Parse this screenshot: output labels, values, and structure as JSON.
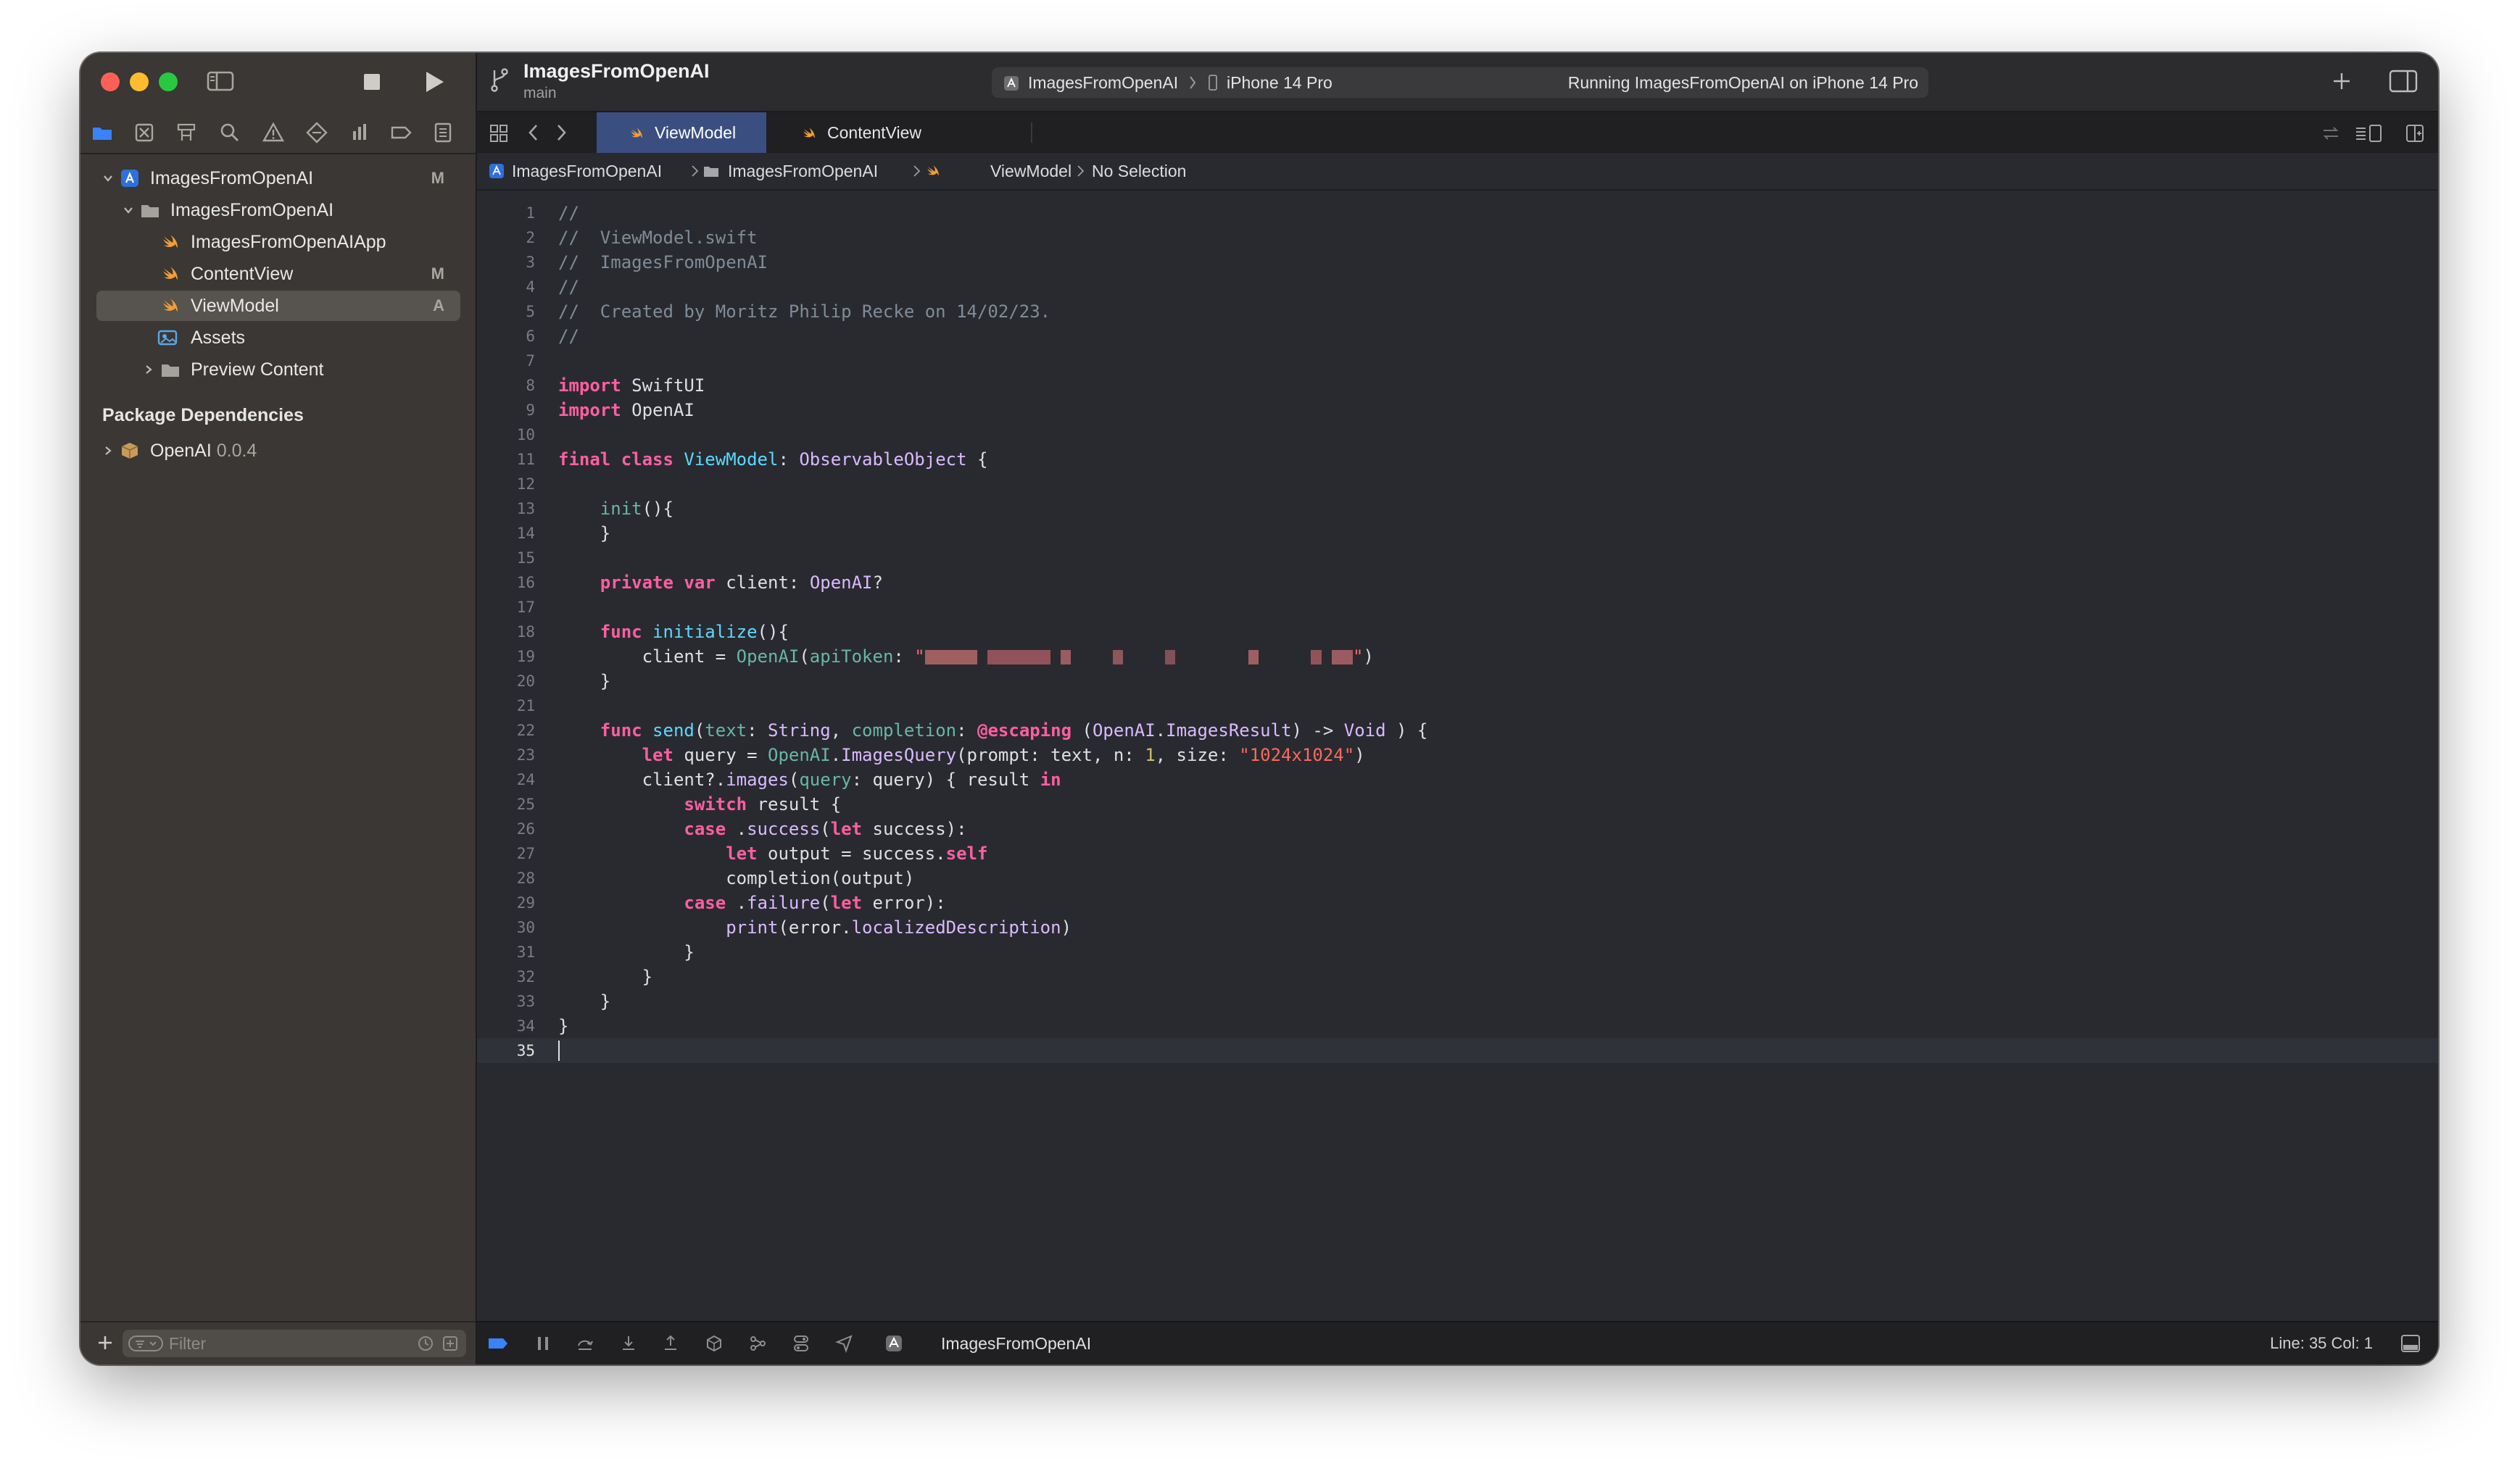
{
  "window": {
    "project_title": "ImagesFromOpenAI",
    "branch": "main"
  },
  "toolbar": {
    "scheme_name": "ImagesFromOpenAI",
    "device_name": "iPhone 14 Pro",
    "run_status": "Running ImagesFromOpenAI on iPhone 14 Pro"
  },
  "navigator": {
    "items": [
      {
        "label": "ImagesFromOpenAI",
        "icon": "xcode-project-icon",
        "badge": "M",
        "expanded": true
      },
      {
        "label": "ImagesFromOpenAI",
        "icon": "folder-icon",
        "badge": "",
        "expanded": true
      },
      {
        "label": "ImagesFromOpenAIApp",
        "icon": "swift-file-icon",
        "badge": ""
      },
      {
        "label": "ContentView",
        "icon": "swift-file-icon",
        "badge": "M"
      },
      {
        "label": "ViewModel",
        "icon": "swift-file-icon",
        "badge": "A",
        "selected": true
      },
      {
        "label": "Assets",
        "icon": "asset-catalog-icon",
        "badge": ""
      },
      {
        "label": "Preview Content",
        "icon": "folder-icon",
        "badge": "",
        "expanded": false
      }
    ],
    "package_header": "Package Dependencies",
    "package": {
      "name": "OpenAI",
      "version": "0.0.4",
      "icon": "package-icon"
    },
    "filter_placeholder": "Filter"
  },
  "tabs": [
    {
      "label": "ViewModel",
      "active": true
    },
    {
      "label": "ContentView",
      "active": false
    }
  ],
  "jumpbar": {
    "project": "ImagesFromOpenAI",
    "group": "ImagesFromOpenAI",
    "file": "ViewModel",
    "selection": "No Selection"
  },
  "editor": {
    "current_line": 35,
    "lines": [
      "//",
      "//  ViewModel.swift",
      "//  ImagesFromOpenAI",
      "//",
      "//  Created by Moritz Philip Recke on 14/02/23.",
      "//",
      "",
      "import SwiftUI",
      "import OpenAI",
      "",
      "final class ViewModel: ObservableObject {",
      "",
      "    init(){",
      "    }",
      "",
      "    private var client: OpenAI?",
      "",
      "    func initialize(){",
      "        client = OpenAI(apiToken: \"█████████████████████████████████████████\")",
      "    }",
      "",
      "    func send(text: String, completion: @escaping (OpenAI.ImagesResult) -> Void ) {",
      "        let query = OpenAI.ImagesQuery(prompt: text, n: 1, size: \"1024x1024\")",
      "        client?.images(query: query) { result in",
      "            switch result {",
      "            case .success(let success):",
      "                let output = success.self",
      "                completion(output)",
      "            case .failure(let error):",
      "                print(error.localizedDescription)",
      "            }",
      "        }",
      "    }",
      "}",
      ""
    ]
  },
  "debug_bar": {
    "target": "ImagesFromOpenAI",
    "position": "Line: 35  Col: 1"
  },
  "colors": {
    "keyword": "#fc5fa3",
    "comment": "#7f8c98",
    "type": "#dabaff",
    "declaration": "#5dd8ff",
    "other": "#67b7a4",
    "string": "#fc6a5d",
    "number": "#d0bf69",
    "accent": "#3b4e80"
  }
}
